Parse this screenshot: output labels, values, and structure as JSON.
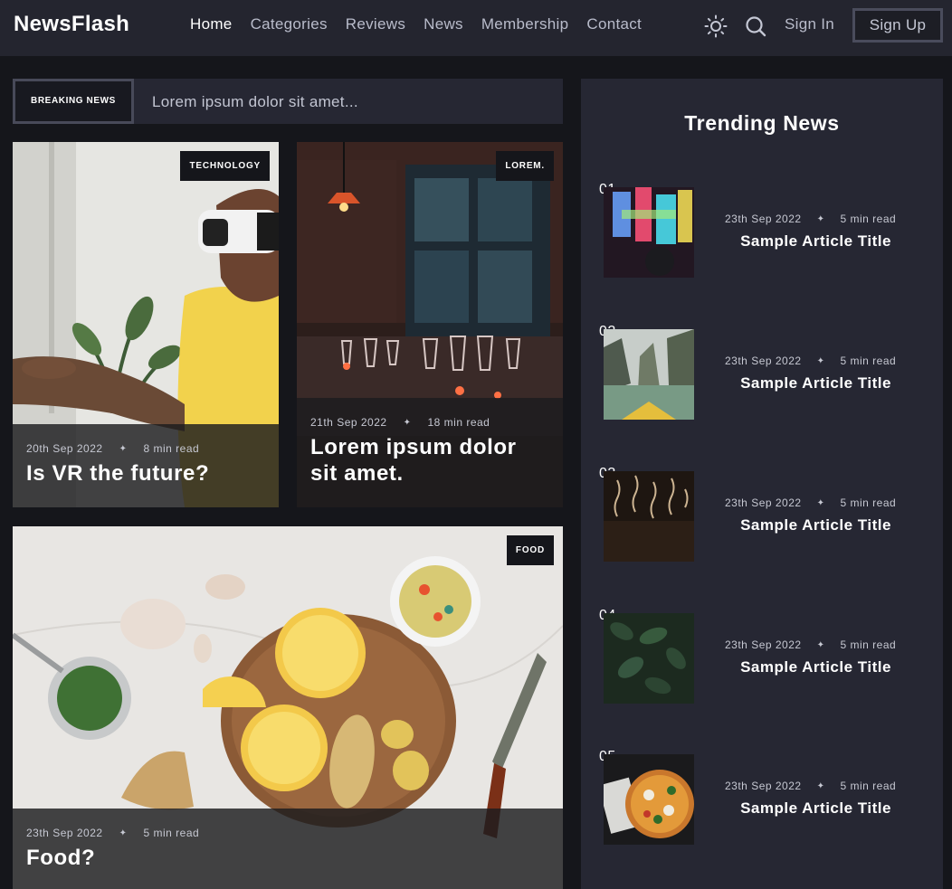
{
  "header": {
    "logo": "NewsFlash",
    "nav": [
      "Home",
      "Categories",
      "Reviews",
      "News",
      "Membership",
      "Contact"
    ],
    "theme_icon": "sun-icon",
    "search_icon": "search-icon",
    "signin": "Sign In",
    "signup": "Sign Up"
  },
  "breaking": {
    "label": "BREAKING NEWS",
    "text": "Lorem ipsum dolor sit amet..."
  },
  "cards": [
    {
      "tag": "TECHNOLOGY",
      "date": "20th Sep 2022",
      "read": "8 min read",
      "title": "Is VR the future?"
    },
    {
      "tag": "LOREM.",
      "date": "21th Sep 2022",
      "read": "18 min read",
      "title": "Lorem ipsum dolor sit amet."
    },
    {
      "tag": "FOOD",
      "date": "23th Sep 2022",
      "read": "5 min read",
      "title": "Food?"
    }
  ],
  "trending": {
    "title": "Trending News",
    "items": [
      {
        "num": "01",
        "date": "23th Sep 2022",
        "read": "5 min read",
        "title": "Sample Article Title"
      },
      {
        "num": "02",
        "date": "23th Sep 2022",
        "read": "5 min read",
        "title": "Sample Article Title"
      },
      {
        "num": "03",
        "date": "23th Sep 2022",
        "read": "5 min read",
        "title": "Sample Article Title"
      },
      {
        "num": "04",
        "date": "23th Sep 2022",
        "read": "5 min read",
        "title": "Sample Article Title"
      },
      {
        "num": "05",
        "date": "23th Sep 2022",
        "read": "5 min read",
        "title": "Sample Article Title"
      }
    ]
  },
  "meta_separator": "✦"
}
